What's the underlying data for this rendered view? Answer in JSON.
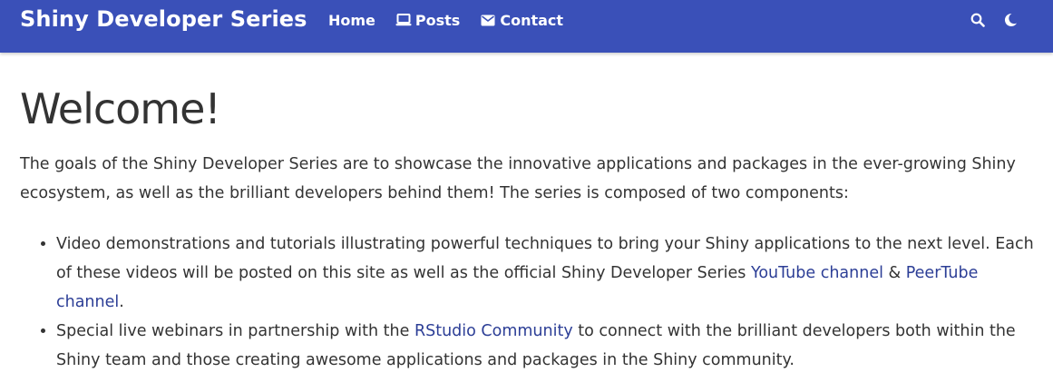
{
  "navbar": {
    "brand": "Shiny Developer Series",
    "links": [
      {
        "label": "Home",
        "icon": "none"
      },
      {
        "label": "Posts",
        "icon": "laptop-icon"
      },
      {
        "label": "Contact",
        "icon": "envelope-icon"
      }
    ],
    "right_icons": [
      "search-icon",
      "moon-icon"
    ],
    "background_color": "#3a50b8"
  },
  "page": {
    "title": "Welcome!",
    "intro": "The goals of the Shiny Developer Series are to showcase the innovative applications and packages in the ever-growing Shiny ecosystem, as well as the brilliant developers behind them! The series is composed of two components:",
    "items": [
      {
        "text_before": "Video demonstrations and tutorials illustrating powerful techniques to bring your Shiny applications to the next level. Each of these videos will be posted on this site as well as the official Shiny Developer Series ",
        "link1": "YouTube channel",
        "text_between": " & ",
        "link2": "PeerTube channel",
        "text_after": "."
      },
      {
        "text_before": "Special live webinars in partnership with the ",
        "link1": "RStudio Community",
        "text_after": " to connect with the brilliant developers both within the Shiny team and those creating awesome applications and packages in the Shiny community."
      }
    ],
    "link_color": "#2c3e96"
  }
}
